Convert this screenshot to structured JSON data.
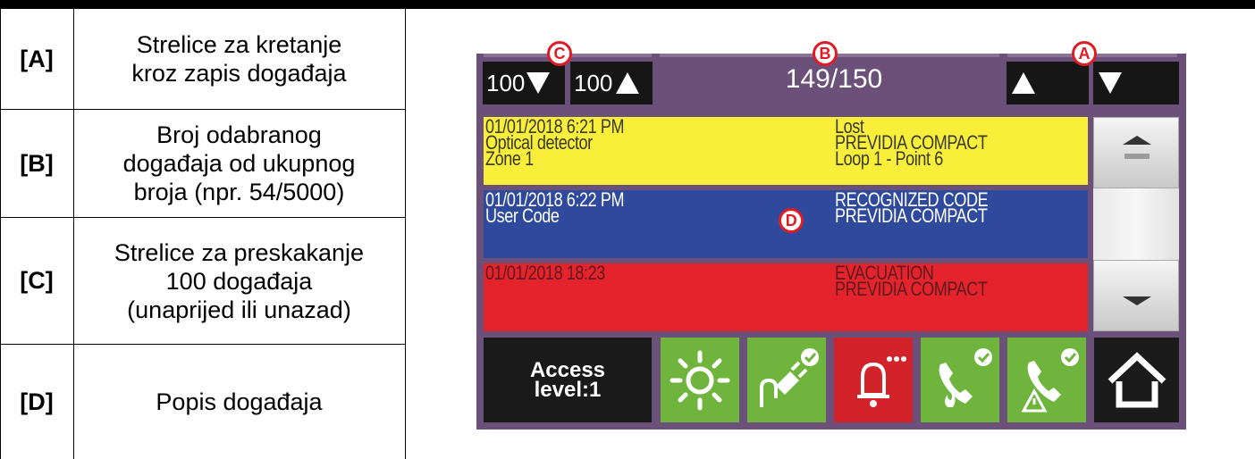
{
  "legend": {
    "rows": [
      {
        "key": "[A]",
        "lines": [
          "Strelice za kretanje",
          "kroz zapis događaja"
        ]
      },
      {
        "key": "[B]",
        "lines": [
          "Broj odabranog",
          "događaja od ukupnog",
          "broja (npr. 54/5000)"
        ]
      },
      {
        "key": "[C]",
        "lines": [
          "Strelice za preskakanje",
          "100 događaja",
          "(unaprijed ili unazad)"
        ]
      },
      {
        "key": "[D]",
        "lines": [
          "Popis događaja"
        ]
      }
    ]
  },
  "panel": {
    "header": {
      "jump_back_label": "100",
      "jump_forward_label": "100",
      "counter": "149/150"
    },
    "callouts": {
      "a": "A",
      "b": "B",
      "c": "C",
      "d": "D"
    },
    "events": [
      {
        "left": [
          "01/01/2018 6:21 PM",
          "Optical detector",
          "Zone 1"
        ],
        "right": [
          "Lost",
          "PREVIDIA COMPACT",
          "Loop 1 - Point 6"
        ],
        "color": "#f9ef3a"
      },
      {
        "left": [
          "01/01/2018 6:22 PM",
          "User Code"
        ],
        "right": [
          "RECOGNIZED CODE",
          "PREVIDIA COMPACT"
        ],
        "color": "#2f4a9c"
      },
      {
        "left": [
          "01/01/2018 18:23"
        ],
        "right": [
          "EVACUATION",
          "PREVIDIA COMPACT"
        ],
        "color": "#e4232d"
      }
    ],
    "bottom_bar": {
      "access_line1": "Access",
      "access_line2": "level:1",
      "icons": [
        "sun-icon",
        "power-plug-check-icon",
        "bell-alarm-icon",
        "phone-fire-check-icon",
        "phone-warning-check-icon",
        "home-icon"
      ]
    }
  },
  "colors": {
    "panel_bg": "#6b5179",
    "green": "#6fb43d",
    "red": "#d2232a",
    "dark": "#1a1a1a",
    "callout": "#e01b24"
  }
}
